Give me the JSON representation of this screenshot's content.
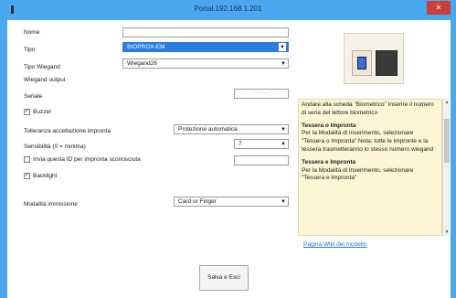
{
  "window": {
    "title": "Portal.192.168.1.201",
    "close_glyph": "✕",
    "system_icon": "app-icon"
  },
  "form": {
    "nome_label": "Nome",
    "tipo_label": "Tipo",
    "tipo_value": "BIOPROX-EM",
    "wiegand_type_label": "Tipo Wiegand",
    "wiegand_type_value": "Wiegand26",
    "wiegand_output_label": "Wiegand output",
    "seriale_label": "Seriale",
    "seriale_value": "- - - - -",
    "buzzer_label": "Buzzer",
    "buzzer_checked": true,
    "tolleranza_label": "Tolleranza accettazione impronta",
    "tolleranza_value": "Protezione automatica",
    "sensibilita_label": "Sensibilità (0 = minima)",
    "sensibilita_value": "7",
    "invia_label": "Invia questa ID per impronta sconosciuta",
    "invia_checked": false,
    "backlight_label": "Backlight",
    "backlight_checked": true,
    "modalita_label": "Modalità immissione",
    "modalita_value": "Card or Finger",
    "save_label": "Salva e Esci",
    "check_glyph": "✓"
  },
  "help": {
    "intro": "Andare alla scheda \"Biometrico\" Inserire il numero di serie del lettore biometrico",
    "section1_title": "Tessera o Impronta",
    "section1_body": "Per la Modalità di inserimento, selezionare \"Tessera o Impronta\" Nota: tutte le impronte e la tessera trasmetteranno lo stesso numero wiegand",
    "section2_title": "Tessera e Impronta",
    "section2_body": "Per la Modalità di inserimento, selezionare \"Tessera e Impronta\"",
    "link": "Pagina Wiki del modello"
  },
  "colors": {
    "titlebar": "#4aa8ef",
    "selection": "#2c7de0",
    "help_bg": "#fcf6d4",
    "close": "#c9403b"
  }
}
